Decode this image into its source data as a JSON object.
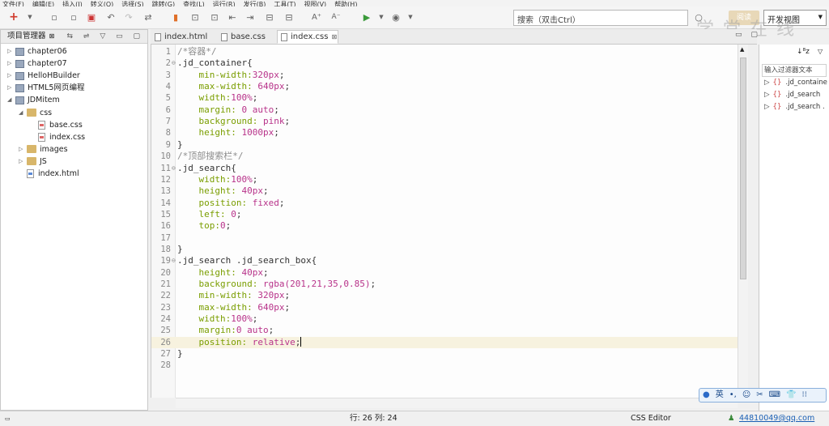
{
  "menu": [
    "文件(F)",
    "编辑(E)",
    "插入(I)",
    "转义(O)",
    "选择(S)",
    "跳转(G)",
    "查找(L)",
    "运行(R)",
    "发行(B)",
    "工具(T)",
    "视图(V)",
    "帮助(H)"
  ],
  "toolbar": {
    "search_placeholder": "搜索（双击Ctrl）",
    "mode_pill": "阅读",
    "view_select": "开发视图",
    "watermark": "学 堂 在 线"
  },
  "project_panel": {
    "title": "项目管理器",
    "items": [
      {
        "label": "chapter06",
        "depth": 0,
        "kind": "project",
        "expanded": false
      },
      {
        "label": "chapter07",
        "depth": 0,
        "kind": "project",
        "expanded": false
      },
      {
        "label": "HelloHBuilder",
        "depth": 0,
        "kind": "project",
        "expanded": false
      },
      {
        "label": "HTML5网页编程",
        "depth": 0,
        "kind": "project",
        "expanded": false
      },
      {
        "label": "JDMitem",
        "depth": 0,
        "kind": "project",
        "expanded": true
      },
      {
        "label": "css",
        "depth": 1,
        "kind": "folder",
        "expanded": true
      },
      {
        "label": "base.css",
        "depth": 2,
        "kind": "css",
        "expanded": null
      },
      {
        "label": "index.css",
        "depth": 2,
        "kind": "css",
        "expanded": null
      },
      {
        "label": "images",
        "depth": 1,
        "kind": "folder",
        "expanded": false
      },
      {
        "label": "JS",
        "depth": 1,
        "kind": "folder",
        "expanded": false
      },
      {
        "label": "index.html",
        "depth": 1,
        "kind": "html",
        "expanded": null
      }
    ]
  },
  "tabs": [
    {
      "label": "index.html",
      "active": false
    },
    {
      "label": "base.css",
      "active": false
    },
    {
      "label": "index.css",
      "active": true
    }
  ],
  "editor": {
    "lines": [
      {
        "n": "1",
        "fold": "",
        "parts": [
          [
            "cm",
            "/*容器*/"
          ]
        ]
      },
      {
        "n": "2",
        "fold": "⊖",
        "parts": [
          [
            "sel",
            ".jd_container{"
          ]
        ]
      },
      {
        "n": "3",
        "fold": "",
        "parts": [
          [
            "sp",
            "    "
          ],
          [
            "prop",
            "min-width:"
          ],
          [
            "val",
            "320px"
          ],
          [
            "sel",
            ";"
          ]
        ]
      },
      {
        "n": "4",
        "fold": "",
        "parts": [
          [
            "sp",
            "    "
          ],
          [
            "prop",
            "max-width: "
          ],
          [
            "val",
            "640px"
          ],
          [
            "sel",
            ";"
          ]
        ]
      },
      {
        "n": "5",
        "fold": "",
        "parts": [
          [
            "sp",
            "    "
          ],
          [
            "prop",
            "width:"
          ],
          [
            "val",
            "100%"
          ],
          [
            "sel",
            ";"
          ]
        ]
      },
      {
        "n": "6",
        "fold": "",
        "parts": [
          [
            "sp",
            "    "
          ],
          [
            "prop",
            "margin: "
          ],
          [
            "val",
            "0 auto"
          ],
          [
            "sel",
            ";"
          ]
        ]
      },
      {
        "n": "7",
        "fold": "",
        "parts": [
          [
            "sp",
            "    "
          ],
          [
            "prop",
            "background: "
          ],
          [
            "val",
            "pink"
          ],
          [
            "sel",
            ";"
          ]
        ]
      },
      {
        "n": "8",
        "fold": "",
        "parts": [
          [
            "sp",
            "    "
          ],
          [
            "prop",
            "height: "
          ],
          [
            "val",
            "1000px"
          ],
          [
            "sel",
            ";"
          ]
        ]
      },
      {
        "n": "9",
        "fold": "",
        "parts": [
          [
            "sel",
            "}"
          ]
        ]
      },
      {
        "n": "10",
        "fold": "",
        "parts": [
          [
            "cm",
            "/*顶部搜索栏*/"
          ]
        ]
      },
      {
        "n": "11",
        "fold": "⊖",
        "parts": [
          [
            "sel",
            ".jd_search{"
          ]
        ]
      },
      {
        "n": "12",
        "fold": "",
        "parts": [
          [
            "sp",
            "    "
          ],
          [
            "prop",
            "width:"
          ],
          [
            "val",
            "100%"
          ],
          [
            "sel",
            ";"
          ]
        ]
      },
      {
        "n": "13",
        "fold": "",
        "parts": [
          [
            "sp",
            "    "
          ],
          [
            "prop",
            "height: "
          ],
          [
            "val",
            "40px"
          ],
          [
            "sel",
            ";"
          ]
        ]
      },
      {
        "n": "14",
        "fold": "",
        "parts": [
          [
            "sp",
            "    "
          ],
          [
            "prop",
            "position: "
          ],
          [
            "val",
            "fixed"
          ],
          [
            "sel",
            ";"
          ]
        ]
      },
      {
        "n": "15",
        "fold": "",
        "parts": [
          [
            "sp",
            "    "
          ],
          [
            "prop",
            "left: "
          ],
          [
            "val",
            "0"
          ],
          [
            "sel",
            ";"
          ]
        ]
      },
      {
        "n": "16",
        "fold": "",
        "parts": [
          [
            "sp",
            "    "
          ],
          [
            "prop",
            "top:"
          ],
          [
            "val",
            "0"
          ],
          [
            "sel",
            ";"
          ]
        ]
      },
      {
        "n": "17",
        "fold": "",
        "parts": []
      },
      {
        "n": "18",
        "fold": "",
        "parts": [
          [
            "sel",
            "}"
          ]
        ]
      },
      {
        "n": "19",
        "fold": "⊖",
        "parts": [
          [
            "sel",
            ".jd_search .jd_search_box{"
          ]
        ]
      },
      {
        "n": "20",
        "fold": "",
        "parts": [
          [
            "sp",
            "    "
          ],
          [
            "prop",
            "height: "
          ],
          [
            "val",
            "40px"
          ],
          [
            "sel",
            ";"
          ]
        ]
      },
      {
        "n": "21",
        "fold": "",
        "parts": [
          [
            "sp",
            "    "
          ],
          [
            "prop",
            "background: "
          ],
          [
            "val",
            "rgba(201,21,35,0.85)"
          ],
          [
            "sel",
            ";"
          ]
        ]
      },
      {
        "n": "22",
        "fold": "",
        "parts": [
          [
            "sp",
            "    "
          ],
          [
            "prop",
            "min-width: "
          ],
          [
            "val",
            "320px"
          ],
          [
            "sel",
            ";"
          ]
        ]
      },
      {
        "n": "23",
        "fold": "",
        "parts": [
          [
            "sp",
            "    "
          ],
          [
            "prop",
            "max-width: "
          ],
          [
            "val",
            "640px"
          ],
          [
            "sel",
            ";"
          ]
        ]
      },
      {
        "n": "24",
        "fold": "",
        "parts": [
          [
            "sp",
            "    "
          ],
          [
            "prop",
            "width:"
          ],
          [
            "val",
            "100%"
          ],
          [
            "sel",
            ";"
          ]
        ]
      },
      {
        "n": "25",
        "fold": "",
        "parts": [
          [
            "sp",
            "    "
          ],
          [
            "prop",
            "margin:"
          ],
          [
            "val",
            "0 auto"
          ],
          [
            "sel",
            ";"
          ]
        ]
      },
      {
        "n": "26",
        "fold": "",
        "parts": [
          [
            "sp",
            "    "
          ],
          [
            "prop",
            "position: "
          ],
          [
            "val",
            "relative"
          ],
          [
            "sel",
            ";"
          ],
          [
            "caret",
            ""
          ]
        ],
        "current": true
      },
      {
        "n": "27",
        "fold": "",
        "parts": [
          [
            "sel",
            "}"
          ]
        ]
      },
      {
        "n": "28",
        "fold": "",
        "parts": []
      }
    ]
  },
  "outline": {
    "filter_placeholder": "输入过滤器文本",
    "items": [
      ".jd_containe",
      ".jd_search",
      ".jd_search ."
    ]
  },
  "status": {
    "position": "行: 26 列: 24",
    "editor_type": "CSS Editor",
    "user": "44810049@qq.com"
  },
  "ime": {
    "lang": "英",
    "items": [
      "•,",
      "☺",
      "✂",
      "⌨",
      "👕",
      "⁝⁝"
    ]
  },
  "colors": {
    "comment": "#8c8c8c",
    "property": "#7a9e00",
    "value": "#b8338a",
    "current_line": "#f7f2df"
  }
}
